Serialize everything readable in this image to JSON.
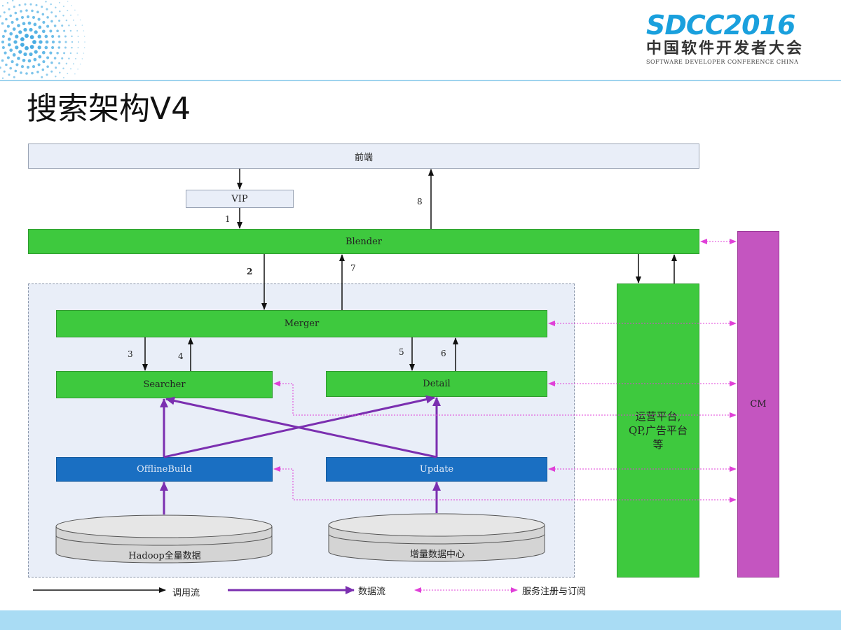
{
  "logo": {
    "main": "SDCC2016",
    "cn": "中国软件开发者大会",
    "en": "SOFTWARE DEVELOPER CONFERENCE CHINA"
  },
  "title": "搜索架构V4",
  "nodes": {
    "frontend": "前端",
    "vip": "VIP",
    "blender": "Blender",
    "merger": "Merger",
    "searcher": "Searcher",
    "detail": "Detail",
    "offline_build": "OfflineBuild",
    "update": "Update",
    "hadoop": "Hadoop全量数据",
    "incremental": "增量数据中心",
    "ops_platform": "运营平台,\nQP,广告平台\n等",
    "cm": "CM"
  },
  "edge_labels": {
    "e1": "1",
    "e2": "2",
    "e3": "3",
    "e4": "4",
    "e5": "5",
    "e6": "6",
    "e7": "7",
    "e8": "8"
  },
  "legend": {
    "call_flow": "调用流",
    "data_flow": "数据流",
    "service_reg": "服务注册与订阅"
  },
  "colors": {
    "green": "#3ec93e",
    "blue": "#1a6fc2",
    "purple": "#c455c0",
    "data_flow": "#7b2fb0",
    "service_reg": "#e040d8",
    "frame_grey": "#e9eef8"
  }
}
